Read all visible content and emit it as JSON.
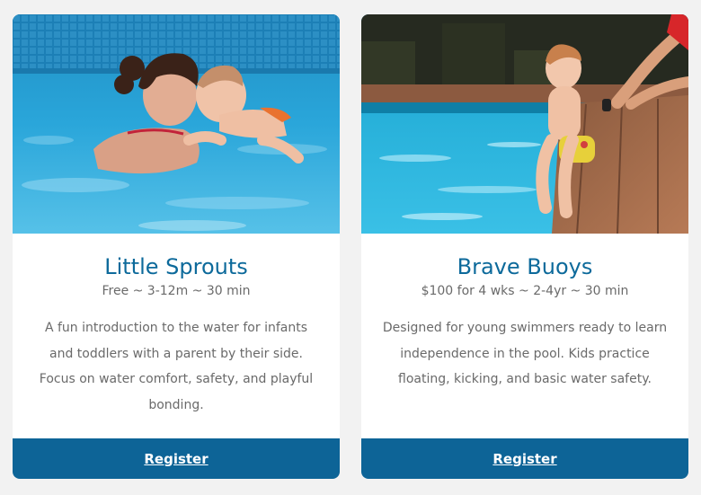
{
  "cards": [
    {
      "title": "Little Sprouts",
      "meta": "Free ~ 3-12m ~ 30 min",
      "description": "A fun introduction to the water for infants and toddlers with a parent by their side. Focus on water comfort, safety, and playful bonding.",
      "button_label": "Register",
      "image": "parent-and-baby-in-indoor-pool-photo"
    },
    {
      "title": "Brave Buoys",
      "meta": "$100 for 4 wks ~ 2-4yr ~ 30 min",
      "description": "Designed for young swimmers ready to learn independence in the pool. Kids practice floating, kicking, and basic water safety.",
      "button_label": "Register",
      "image": "toddler-sitting-on-pool-edge-photo"
    }
  ],
  "colors": {
    "page_background": "#f2f2f2",
    "title": "#0d6a9b",
    "body_text": "#6a6a6a",
    "button": "#0d6497"
  }
}
